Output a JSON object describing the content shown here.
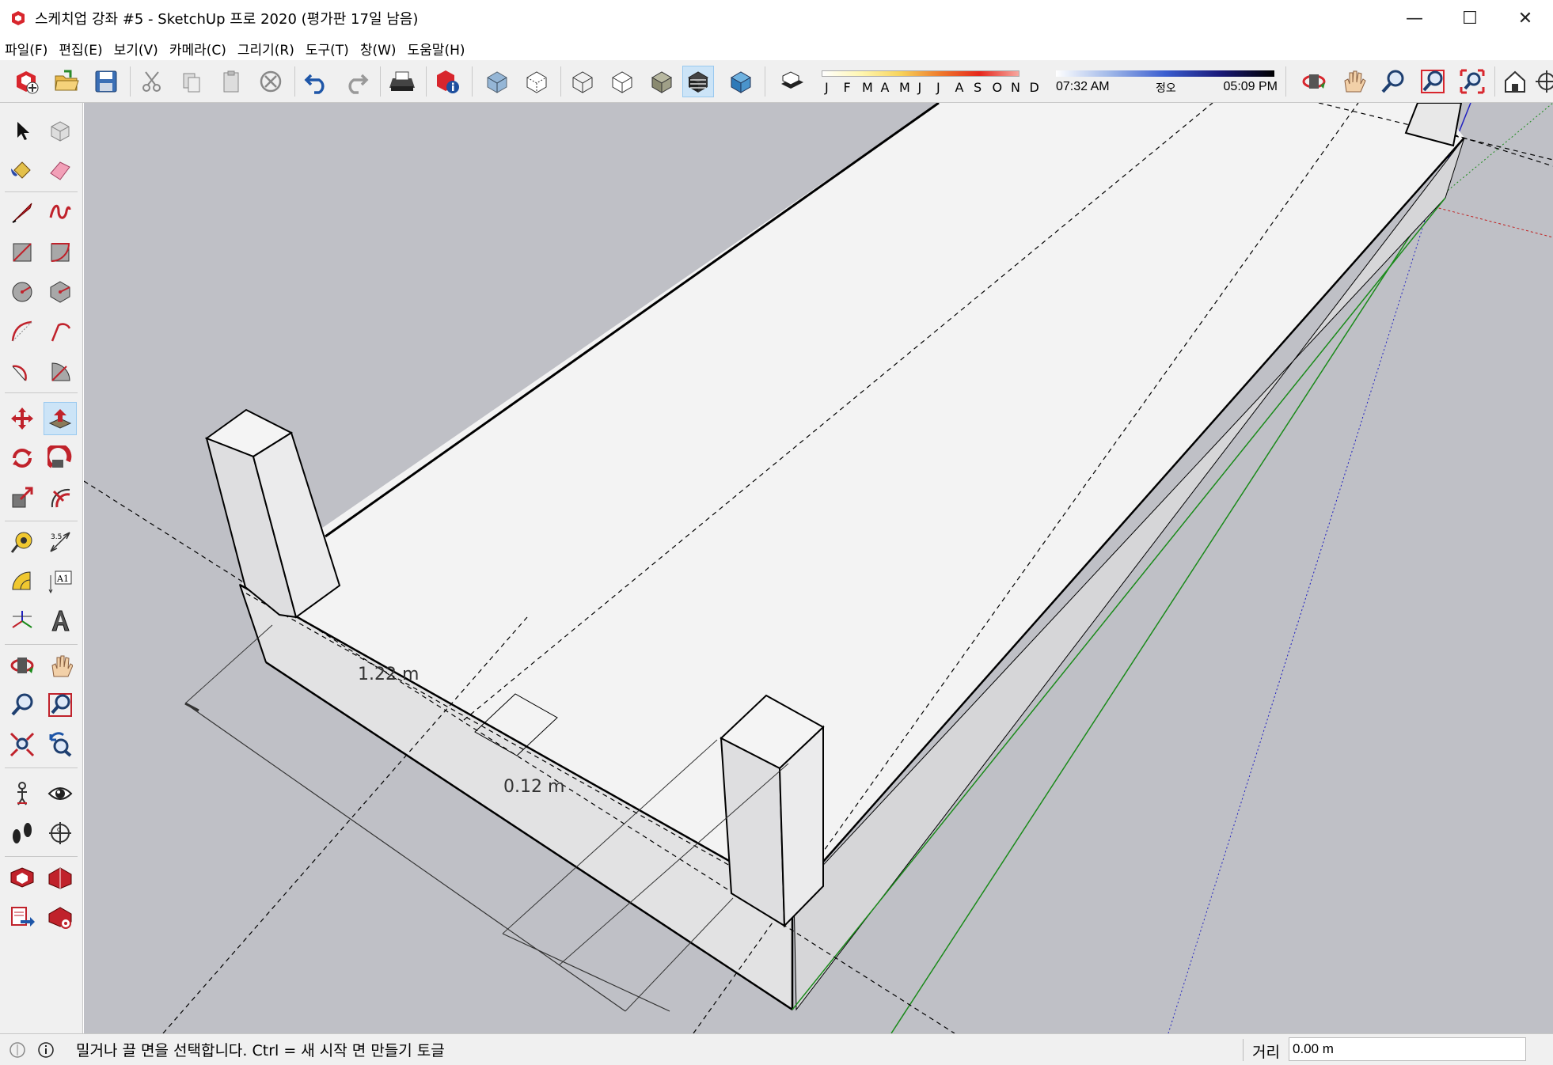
{
  "window": {
    "title": "스케치업 강좌 #5 - SketchUp 프로 2020 (평가판 17일 남음)",
    "minimize": "—",
    "maximize": "☐",
    "close": "✕"
  },
  "menu": {
    "items": [
      "파일(F)",
      "편집(E)",
      "보기(V)",
      "카메라(C)",
      "그리기(R)",
      "도구(T)",
      "창(W)",
      "도움말(H)"
    ]
  },
  "shadows": {
    "months": [
      "J",
      "F",
      "M",
      "A",
      "M",
      "J",
      "J",
      "A",
      "S",
      "O",
      "N",
      "D"
    ],
    "time_start": "07:32 AM",
    "time_mid": "정오",
    "time_end": "05:09 PM"
  },
  "viewport": {
    "dimension_1": "1.22 m",
    "dimension_2": "0.12 m"
  },
  "status": {
    "message": "밀거나 끌 면을 선택합니다. Ctrl = 새 시작 면 만들기 토글",
    "vcb_label": "거리",
    "vcb_value": "0.00 m"
  },
  "colors": {
    "viewport_bg": "#bfc0c6",
    "face_top": "#f4f4f4",
    "face_side": "#d8d8d8",
    "axis_green": "#1a8a1a",
    "axis_blue": "#2020c0",
    "axis_red": "#c02020",
    "active_tool": "#cce4f7"
  },
  "icons": {
    "top_toolbar": [
      "new-icon",
      "open-icon",
      "save-icon",
      "cut-icon",
      "copy-icon",
      "paste-icon",
      "erase-icon",
      "undo-icon",
      "redo-icon",
      "print-icon",
      "model-info-icon",
      "xray-icon",
      "back-edges-icon",
      "wireframe-icon",
      "hidden-line-icon",
      "shaded-icon",
      "shaded-textures-icon",
      "monochrome-icon",
      "shadows-toggle-icon",
      "orbit-icon",
      "pan-icon",
      "zoom-icon",
      "zoom-window-icon",
      "zoom-extents-icon",
      "warehouse-icon"
    ],
    "left_toolbar": [
      "select-icon",
      "make-component-icon",
      "paint-bucket-icon",
      "eraser-icon",
      "line-icon",
      "freehand-icon",
      "rectangle-icon",
      "rotated-rectangle-icon",
      "circle-icon",
      "polygon-icon",
      "arc-icon",
      "two-point-arc-icon",
      "three-point-arc-icon",
      "pie-icon",
      "move-icon",
      "push-pull-icon",
      "rotate-icon",
      "follow-me-icon",
      "scale-icon",
      "offset-icon",
      "tape-measure-icon",
      "dimension-icon",
      "protractor-icon",
      "text-icon",
      "axes-icon",
      "3d-text-icon",
      "orbit-icon",
      "pan-icon",
      "zoom-icon",
      "zoom-window-icon",
      "zoom-extents-icon",
      "previous-view-icon",
      "position-camera-icon",
      "look-around-icon",
      "walk-icon",
      "section-plane-icon",
      "warehouse-icon",
      "extension-warehouse-icon",
      "send-to-layout-icon",
      "extension-manager-icon"
    ]
  }
}
